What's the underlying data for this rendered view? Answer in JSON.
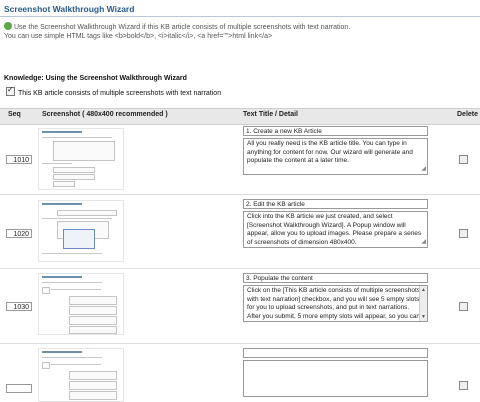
{
  "wizard": {
    "title": "Screenshot Walkthrough Wizard",
    "intro_line1": "Use the Screenshot Walkthrough Wizard if this KB article consists of multiple screenshots with text narration.",
    "intro_line2": "You can use simple HTML tags like <b>bold</b>, <i>italic</i>, <a href=\"\">html link</a>",
    "knowledge_heading": "Knowledge: Using the Screenshot Walkthrough Wizard",
    "checkbox_label": "This KB article consists of multiple screenshots with text narration",
    "checkbox_checked": true
  },
  "table": {
    "headers": {
      "seq": "Seq",
      "screenshot": "Screenshot ( 480x400 recommended )",
      "text": "Text Title / Detail",
      "delete": "Delete"
    },
    "rows": [
      {
        "seq": "1010",
        "title": "1. Create a new KB Article",
        "detail": "All you really need is the KB article title. You can type in anything for content for now. Our wizard will generate and populate the content at a later time."
      },
      {
        "seq": "1020",
        "title": "2. Edit the KB article",
        "detail": "Click into the KB article we just created, and select [Screenshot Walkthrough Wizard]. A Popup window will appear, allow you to upload images. Please prepare a series of screenshots of dimension 480x400."
      },
      {
        "seq": "1030",
        "title": "3. Populate the content",
        "detail": "Click on the [This KB article consists of multiple screenshots with text narration] checkbox, and you will see 5 empty slots for you to upload screenshots, and put in text narrations. After you submit, 5 more empty slots will appear, so you can"
      },
      {
        "seq": "",
        "title": "",
        "detail": ""
      }
    ]
  },
  "icons": {
    "info": "info-icon",
    "resize": "resize-grip-icon"
  }
}
